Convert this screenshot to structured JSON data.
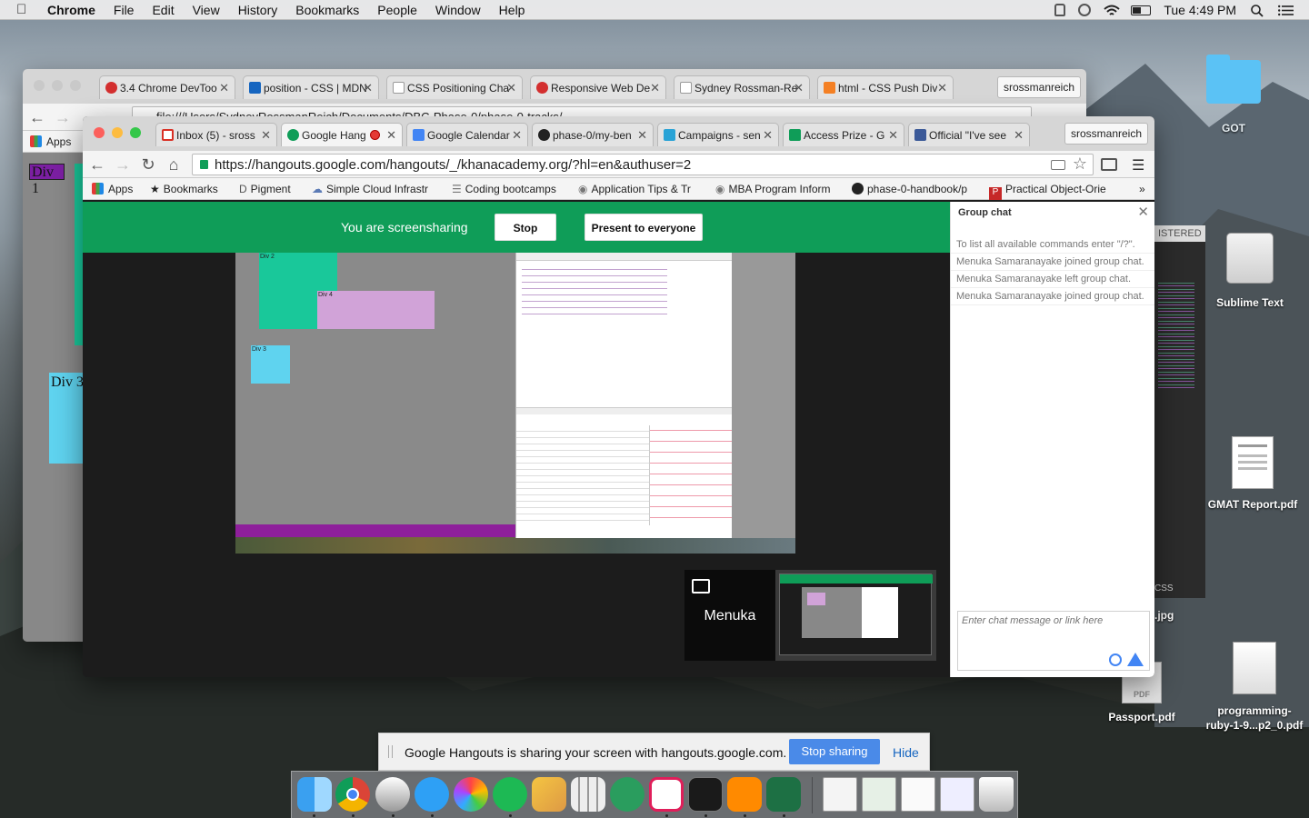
{
  "menubar": {
    "app": "Chrome",
    "items": [
      "File",
      "Edit",
      "View",
      "History",
      "Bookmarks",
      "People",
      "Window",
      "Help"
    ],
    "clock": "Tue 4:49 PM"
  },
  "back_window": {
    "tabs": [
      {
        "label": "3.4 Chrome DevToo",
        "fav": "#d32f2f"
      },
      {
        "label": "position - CSS | MDN",
        "fav": "#1565c0"
      },
      {
        "label": "CSS Positioning Cha",
        "fav": "#ffffff"
      },
      {
        "label": "Responsive Web De",
        "fav": "#d32f2f"
      },
      {
        "label": "Sydney Rossman-Re",
        "fav": "#ffffff"
      },
      {
        "label": "html - CSS Push Div",
        "fav": "#f48024"
      }
    ],
    "profile": "srossmanreich",
    "apps_label": "Apps",
    "url_partial": "file:///Users/SydneyRossmanReich/Documents/DBC-Phase-0/phase-0-tracks/..."
  },
  "page_divs": {
    "div1": "Div 1",
    "div3": "Div 3"
  },
  "front_window": {
    "tabs": [
      {
        "label": "Inbox (5) - sross",
        "fav": "#d93025"
      },
      {
        "label": "Google Hang",
        "fav": "#0f9d58"
      },
      {
        "label": "Google Calendar",
        "fav": "#4285f4"
      },
      {
        "label": "phase-0/my-ben",
        "fav": "#222222"
      },
      {
        "label": "Campaigns - sen",
        "fav": "#29a3d6"
      },
      {
        "label": "Access Prize - G",
        "fav": "#0f9d58"
      },
      {
        "label": "Official \"I've see",
        "fav": "#3b5998"
      }
    ],
    "profile": "srossmanreich",
    "url": "https://hangouts.google.com/hangouts/_/khanacademy.org/?hl=en&authuser=2",
    "bookmarks": [
      {
        "label": "Apps",
        "icon": "apps-grid-icon"
      },
      {
        "label": "Bookmarks",
        "icon": "star-icon"
      },
      {
        "label": "Pigment",
        "icon": "pigment-icon"
      },
      {
        "label": "Simple Cloud Infrastr",
        "icon": "cloud-icon"
      },
      {
        "label": "Coding bootcamps",
        "icon": "list-icon"
      },
      {
        "label": "Application Tips & Tr",
        "icon": "globe-icon"
      },
      {
        "label": "MBA Program Inform",
        "icon": "globe-icon"
      },
      {
        "label": "phase-0-handbook/p",
        "icon": "github-icon"
      },
      {
        "label": "Practical Object-Orie",
        "icon": "p-icon"
      }
    ]
  },
  "hangout": {
    "screenshare_text": "You are screensharing",
    "stop_label": "Stop",
    "present_label": "Present to everyone",
    "participant_name": "Menuka",
    "mini_labels": {
      "div2": "Div 2",
      "div4": "Div 4",
      "div3": "Div 3"
    }
  },
  "chat": {
    "title": "Group chat",
    "messages": [
      "To list all available commands enter \"/?\".",
      "Menuka Samaranayake joined group chat.",
      "Menuka Samaranayake left group chat.",
      "Menuka Samaranayake joined group chat."
    ],
    "input_placeholder": "Enter chat message or link here"
  },
  "share_notification": {
    "text": "Google Hangouts is sharing your screen with hangouts.google.com.",
    "stop_label": "Stop sharing",
    "hide_label": "Hide"
  },
  "desktop": {
    "icons": [
      "GOT",
      "Sublime Text",
      "GMAT Report.pdf",
      "Passport.pdf",
      "programming-ruby-1-9...p2_0.pdf"
    ],
    "peek_text": {
      "registered": "ISTERED",
      "css": "CSS",
      "jpg": ".jpg"
    }
  }
}
